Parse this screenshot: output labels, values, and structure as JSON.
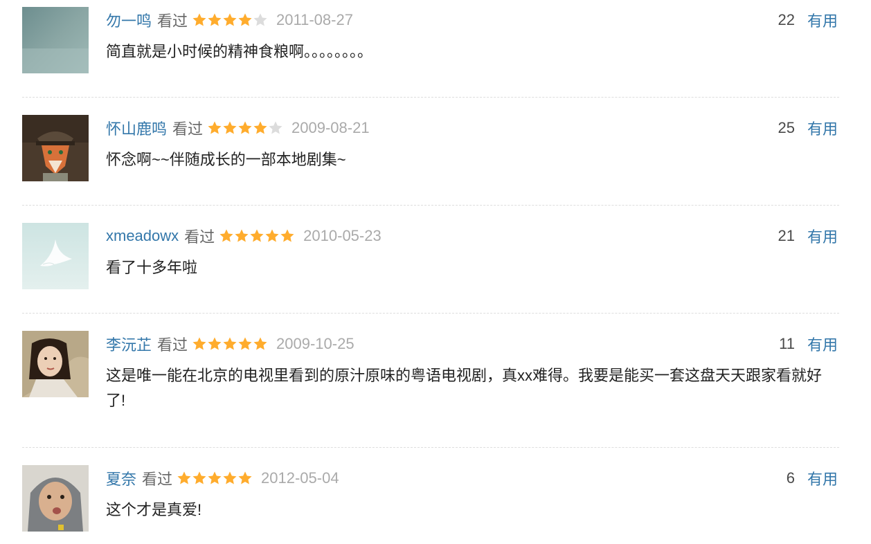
{
  "comments": [
    {
      "user": "勿一鸣",
      "status": "看过",
      "rating": 4,
      "date": "2011-08-27",
      "votes": "22",
      "vote_label": "有用",
      "text": "简直就是小时候的精神食粮啊。。。。。。。。"
    },
    {
      "user": "怀山鹿鸣",
      "status": "看过",
      "rating": 4,
      "date": "2009-08-21",
      "votes": "25",
      "vote_label": "有用",
      "text": "怀念啊~~伴随成长的一部本地剧集~"
    },
    {
      "user": "xmeadowx",
      "status": "看过",
      "rating": 5,
      "date": "2010-05-23",
      "votes": "21",
      "vote_label": "有用",
      "text": "看了十多年啦"
    },
    {
      "user": "李沅芷",
      "status": "看过",
      "rating": 5,
      "date": "2009-10-25",
      "votes": "11",
      "vote_label": "有用",
      "text": "这是唯一能在北京的电视里看到的原汁原味的粤语电视剧，真xx难得。我要是能买一套这盘天天跟家看就好了!"
    },
    {
      "user": "夏奈",
      "status": "看过",
      "rating": 5,
      "date": "2012-05-04",
      "votes": "6",
      "vote_label": "有用",
      "text": "这个才是真爱!"
    }
  ],
  "colors": {
    "link": "#3377aa",
    "star_on": "#ffac2d",
    "star_off": "#dcdcdc",
    "date": "#aaaaaa"
  },
  "icons": {
    "star": "star-icon",
    "star_empty": "star-empty-icon"
  }
}
